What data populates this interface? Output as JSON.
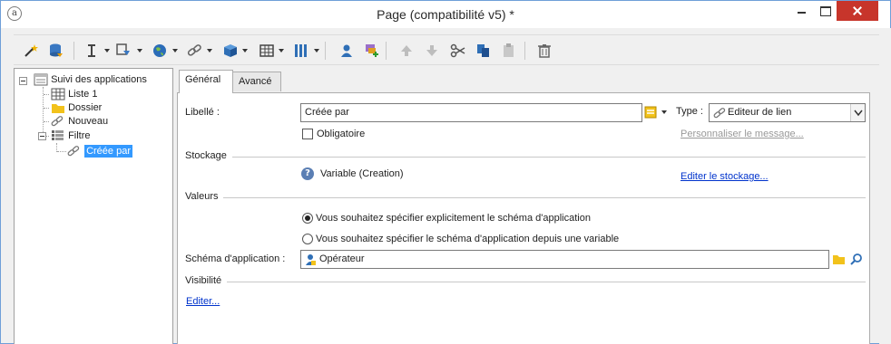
{
  "window": {
    "title": "Page (compatibilité v5) *"
  },
  "toolbar": {
    "icons": [
      "wizard-icon",
      "database-icon",
      "insert-text-icon",
      "insert-field-icon",
      "globe-icon",
      "link-icon",
      "box-icon",
      "table-icon",
      "columns-icon",
      "user-icon",
      "add-image-icon",
      "move-up-icon",
      "move-down-icon",
      "cut-icon",
      "copy-icon",
      "paste-icon",
      "delete-icon"
    ]
  },
  "tree": {
    "root": "Suivi des applications",
    "items": [
      "Liste 1",
      "Dossier",
      "Nouveau",
      "Filtre"
    ],
    "selected": "Créée par"
  },
  "tabs": [
    "Général",
    "Avancé"
  ],
  "form": {
    "libelle_label": "Libellé :",
    "libelle_value": "Créée par",
    "type_label": "Type :",
    "type_value": "Editeur de lien",
    "obligatoire": "Obligatoire",
    "personnaliser": "Personnaliser le message...",
    "stockage_section": "Stockage",
    "stockage_value": "Variable (Creation)",
    "editer_stockage": "Editer le stockage...",
    "valeurs_section": "Valeurs",
    "radio1": "Vous souhaitez spécifier explicitement le schéma d'application",
    "radio2": "Vous souhaitez spécifier le schéma d'application depuis une variable",
    "schema_label": "Schéma d'application :",
    "schema_value": "Opérateur",
    "visibilite_section": "Visibilité",
    "editer": "Editer..."
  },
  "colors": {
    "accent": "#3399ff",
    "close": "#c7352b",
    "link": "#0033cc"
  }
}
